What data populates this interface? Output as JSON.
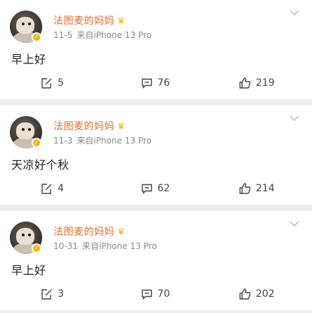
{
  "posts": [
    {
      "author": "法图麦的妈妈",
      "date": "11-5",
      "source": "来自iPhone 13 Pro",
      "content": "早上好",
      "reposts": "5",
      "comments": "76",
      "likes": "219"
    },
    {
      "author": "法图麦的妈妈",
      "date": "11-3",
      "source": "来自iPhone 13 Pro",
      "content": "天凉好个秋",
      "reposts": "4",
      "comments": "62",
      "likes": "214"
    },
    {
      "author": "法图麦的妈妈",
      "date": "10-31",
      "source": "来自iPhone 13 Pro",
      "content": "早上好",
      "reposts": "3",
      "comments": "70",
      "likes": "202"
    }
  ],
  "icons": {
    "more": "chevron-down-icon",
    "verified": "verified-badge-icon",
    "vip": "crown-icon",
    "repost": "repost-icon",
    "comment": "comment-icon",
    "like": "thumbs-up-icon"
  },
  "colors": {
    "author_name": "#e86b2c",
    "badge": "#f3b600",
    "meta_text": "#8a8a8a",
    "feed_background": "#efeff1"
  }
}
